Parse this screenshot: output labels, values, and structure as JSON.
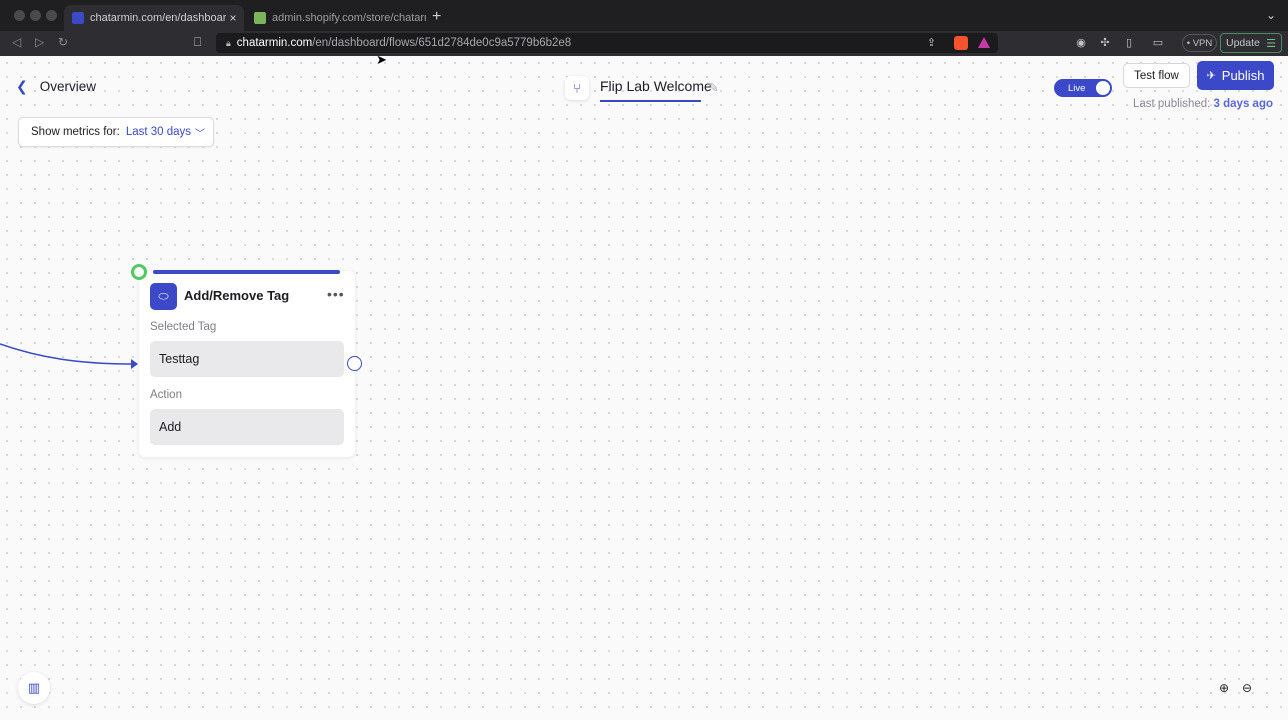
{
  "browser": {
    "tabs": [
      {
        "title": "chatarmin.com/en/dashboard/fl",
        "close": "×",
        "favicon_color": "#3b48c7"
      },
      {
        "title": "admin.shopify.com/store/chatarmin",
        "favicon_color": "#7ab55c"
      }
    ],
    "new_tab": "+",
    "tabs_menu": "⌄",
    "url_host": "chatarmin.com",
    "url_path": "/en/dashboard/flows/651d2784de0c9a5779b6b2e8",
    "vpn_label": "• VPN",
    "update_label": "Update"
  },
  "header": {
    "back_label": "Overview",
    "flow_title": "Flip Lab Welcome",
    "live_label": "Live",
    "test_flow_label": "Test flow",
    "publish_label": "Publish",
    "last_published_label": "Last published:",
    "last_published_value": "3 days ago"
  },
  "metrics": {
    "label": "Show metrics for:",
    "selected": "Last 30 days"
  },
  "node": {
    "title": "Add/Remove Tag",
    "more": "•••",
    "selected_tag_label": "Selected Tag",
    "selected_tag_value": "Testtag",
    "action_label": "Action",
    "action_value": "Add"
  },
  "colors": {
    "accent": "#3b48c7",
    "start_dot": "#4fca62"
  }
}
